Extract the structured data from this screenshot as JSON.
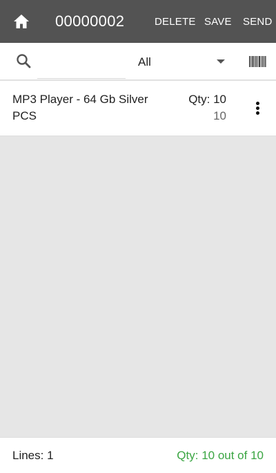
{
  "appbar": {
    "home_icon": "home-icon",
    "title": "00000002",
    "delete_label": "DELETE",
    "save_label": "SAVE",
    "send_label": "SEND",
    "background": "#535353"
  },
  "filterbar": {
    "search_icon": "search-icon",
    "filter_value": "All",
    "dropdown_icon": "chevron-down-icon",
    "barcode_icon": "barcode-icon"
  },
  "items": [
    {
      "name": "MP3 Player - 64 Gb Silver PCS",
      "qty_label": "Qty: 10",
      "counted": "10",
      "menu_icon": "more-vert-icon"
    }
  ],
  "footer": {
    "lines": "Lines: 1",
    "qty_summary": "Qty: 10 out of 10",
    "summary_color": "#3aa542"
  }
}
